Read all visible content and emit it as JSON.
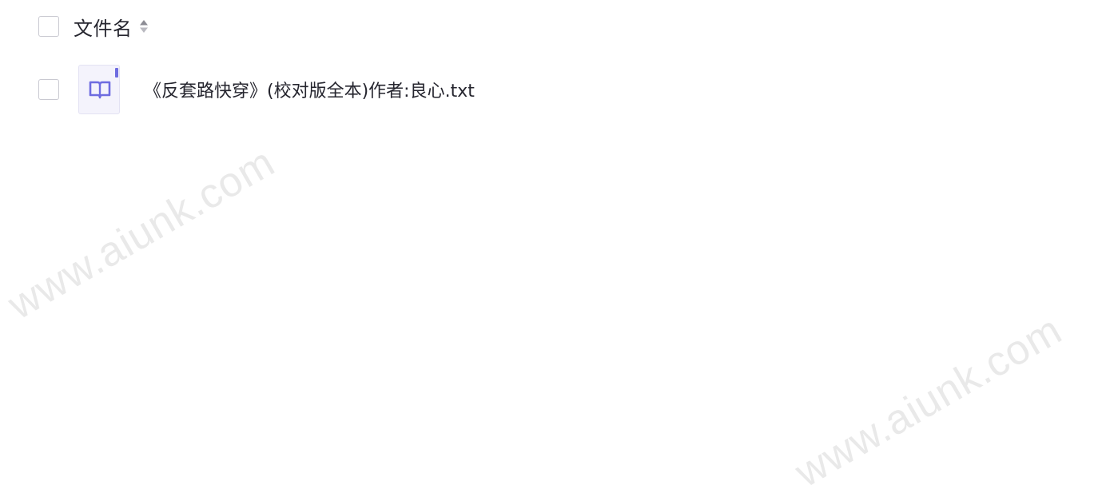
{
  "file_list": {
    "header": {
      "column_label": "文件名",
      "sort_icon": "sort-icon"
    },
    "rows": [
      {
        "file_icon": "book-icon",
        "name": "《反套路快穿》(校对版全本)作者:良心.txt"
      }
    ]
  },
  "watermark": {
    "text": "www.aiunk.com"
  },
  "colors": {
    "accent": "#6e6ce0",
    "text": "#25252e",
    "checkbox_border": "#c9c9d1",
    "icon_bg": "#f4f3fc"
  }
}
